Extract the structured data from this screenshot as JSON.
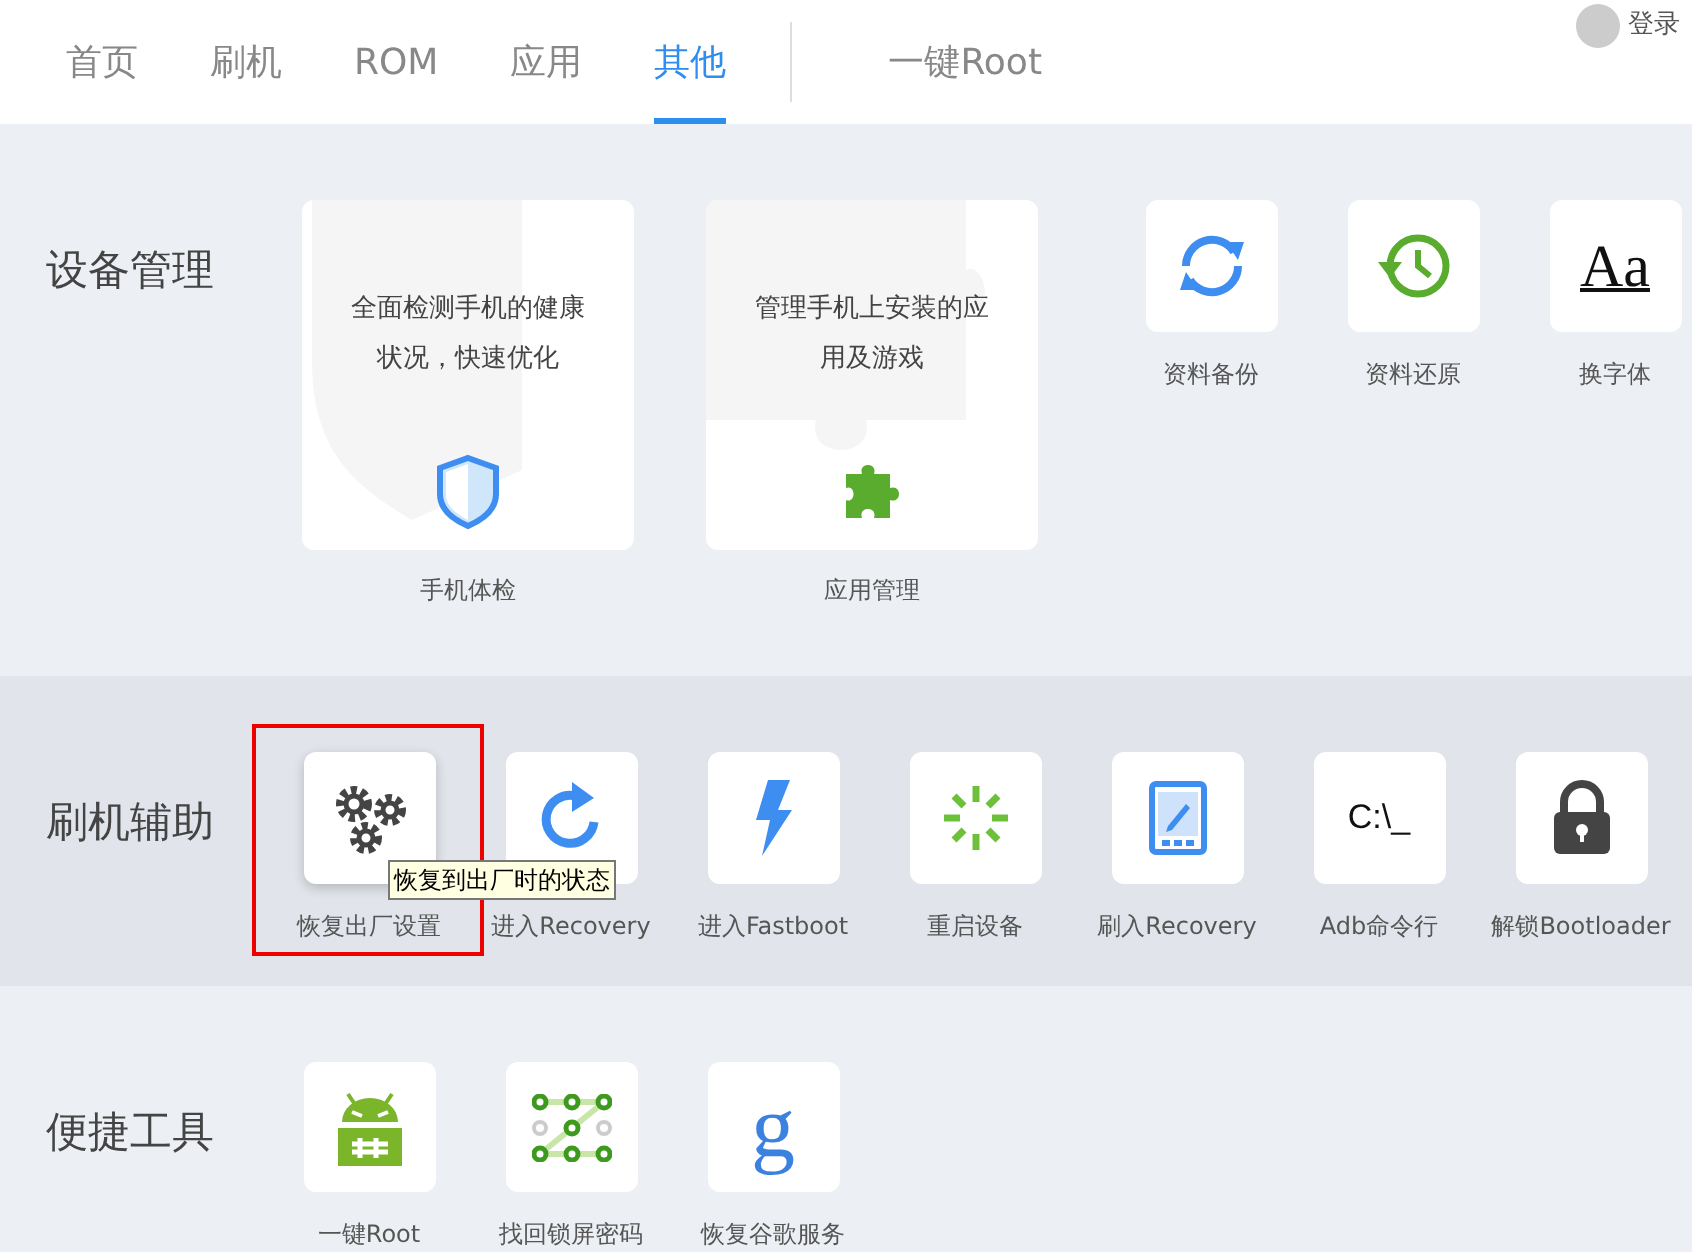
{
  "tabs": [
    {
      "label": "首页",
      "selected": false
    },
    {
      "label": "刷机",
      "selected": false
    },
    {
      "label": "ROM",
      "selected": false
    },
    {
      "label": "应用",
      "selected": false
    },
    {
      "label": "其他",
      "selected": true
    }
  ],
  "extra_tabs": [
    {
      "label": "一键Root",
      "selected": false
    }
  ],
  "login": {
    "label": "登录"
  },
  "sections": [
    {
      "title": "设备管理",
      "items": [
        {
          "kind": "card",
          "label": "手机体检",
          "description": "全面检测手机的健康状况，快速优化"
        },
        {
          "kind": "card",
          "label": "应用管理",
          "description": "管理手机上安装的应用及游戏"
        },
        {
          "kind": "tile",
          "label": "资料备份"
        },
        {
          "kind": "tile",
          "label": "资料还原"
        },
        {
          "kind": "tile",
          "label": "换字体",
          "glyph": "Aa"
        }
      ]
    },
    {
      "title": "刷机辅助",
      "items": [
        {
          "kind": "tile",
          "label": "恢复出厂设置",
          "highlighted": true,
          "tooltip": "恢复到出厂时的状态"
        },
        {
          "kind": "tile",
          "label": "进入Recovery"
        },
        {
          "kind": "tile",
          "label": "进入Fastboot"
        },
        {
          "kind": "tile",
          "label": "重启设备"
        },
        {
          "kind": "tile",
          "label": "刷入Recovery"
        },
        {
          "kind": "tile",
          "label": "Adb命令行",
          "glyph": "C:\\_"
        },
        {
          "kind": "tile",
          "label": "解锁Bootloader"
        }
      ]
    },
    {
      "title": "便捷工具",
      "items": [
        {
          "kind": "tile",
          "label": "一键Root"
        },
        {
          "kind": "tile",
          "label": "找回锁屏密码"
        },
        {
          "kind": "tile",
          "label": "恢复谷歌服务",
          "glyph": "g"
        }
      ]
    }
  ]
}
